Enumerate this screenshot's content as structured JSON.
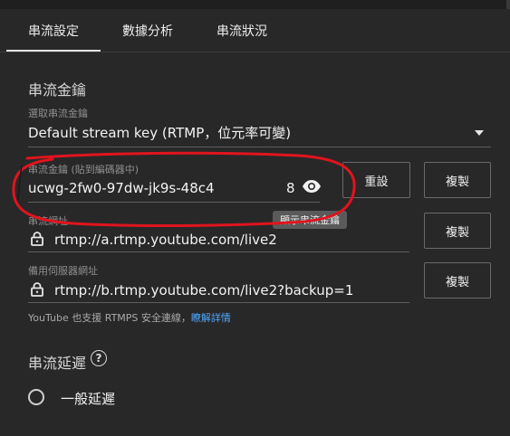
{
  "tabs": [
    {
      "label": "串流設定"
    },
    {
      "label": "數據分析"
    },
    {
      "label": "串流狀況"
    }
  ],
  "stream_key_section": {
    "title": "串流金鑰",
    "select": {
      "label": "選取串流金鑰",
      "value": "Default stream key (RTMP，位元率可變)"
    },
    "key_field": {
      "label": "串流金鑰 (貼到編碼器中)",
      "value": "ucwg-2fw0-97dw-jk9s-48c4",
      "counter": "8",
      "tooltip": "顯示串流金鑰"
    },
    "reset_label": "重設",
    "copy_label": "複製",
    "url_field": {
      "label": "串流網址",
      "value": "rtmp://a.rtmp.youtube.com/live2"
    },
    "backup_field": {
      "label": "備用伺服器網址",
      "value": "rtmp://b.rtmp.youtube.com/live2?backup=1"
    },
    "note_text": "YouTube 也支援 RTMPS 安全連線，",
    "note_link": "瞭解詳情"
  },
  "latency_section": {
    "title": "串流延遲",
    "help_icon_text": "?",
    "option_label": "一般延遲"
  },
  "colors": {
    "background": "#282828",
    "annotation": "#e0141e",
    "link": "#4ea8ff"
  }
}
